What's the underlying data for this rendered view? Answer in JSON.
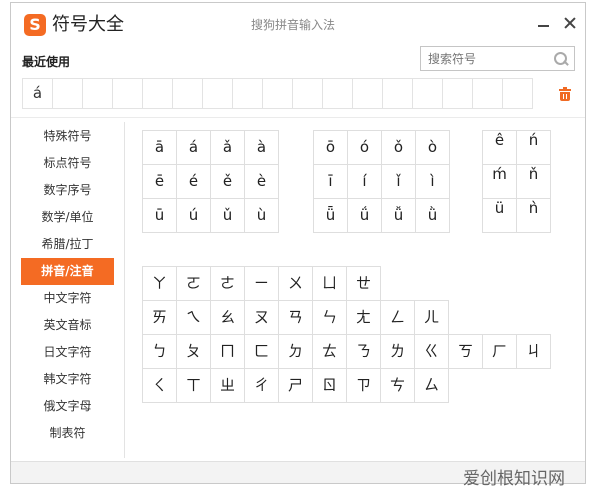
{
  "app": {
    "logo_text": "S",
    "title": "符号大全",
    "window_title": "搜狗拼音输入法"
  },
  "recent": {
    "label": "最近使用",
    "items": [
      "á",
      "",
      "",
      "",
      "",
      "",
      "",
      "",
      "",
      "",
      "",
      "",
      "",
      "",
      "",
      "",
      ""
    ]
  },
  "search": {
    "placeholder": "搜索符号"
  },
  "sidebar": {
    "items": [
      {
        "label": "特殊符号"
      },
      {
        "label": "标点符号"
      },
      {
        "label": "数字序号"
      },
      {
        "label": "数学/单位"
      },
      {
        "label": "希腊/拉丁"
      },
      {
        "label": "拼音/注音",
        "active": true
      },
      {
        "label": "中文字符"
      },
      {
        "label": "英文音标"
      },
      {
        "label": "日文字符"
      },
      {
        "label": "韩文字符"
      },
      {
        "label": "俄文字母"
      },
      {
        "label": "制表符"
      }
    ]
  },
  "pinyin_groups": [
    [
      "ā",
      "á",
      "ǎ",
      "à",
      "ē",
      "é",
      "ě",
      "è",
      "ū",
      "ú",
      "ǔ",
      "ù"
    ],
    [
      "ō",
      "ó",
      "ǒ",
      "ò",
      "ī",
      "í",
      "ǐ",
      "ì",
      "ǖ",
      "ǘ",
      "ǚ",
      "ǜ"
    ],
    [
      "ê",
      "ń",
      "ḿ",
      "ň",
      "ü",
      "ǹ"
    ]
  ],
  "zhuyin_rows": [
    [
      "ㄚ",
      "ㄛ",
      "ㄜ",
      "ㄧ",
      "ㄨ",
      "ㄩ",
      "ㄝ"
    ],
    [
      "ㄞ",
      "ㄟ",
      "ㄠ",
      "ㄡ",
      "ㄢ",
      "ㄣ",
      "ㄤ",
      "ㄥ",
      "ㄦ"
    ],
    [
      "ㄅ",
      "ㄆ",
      "ㄇ",
      "ㄈ",
      "ㄉ",
      "ㄊ",
      "ㄋ",
      "ㄌ",
      "ㄍ",
      "ㄎ",
      "ㄏ",
      "ㄐ"
    ],
    [
      "ㄑ",
      "ㄒ",
      "ㄓ",
      "ㄔ",
      "ㄕ",
      "ㄖ",
      "ㄗ",
      "ㄘ",
      "ㄙ"
    ]
  ],
  "watermark": "爱创根知识网",
  "colors": {
    "accent": "#f46b23",
    "grid_border": "#dedede"
  }
}
